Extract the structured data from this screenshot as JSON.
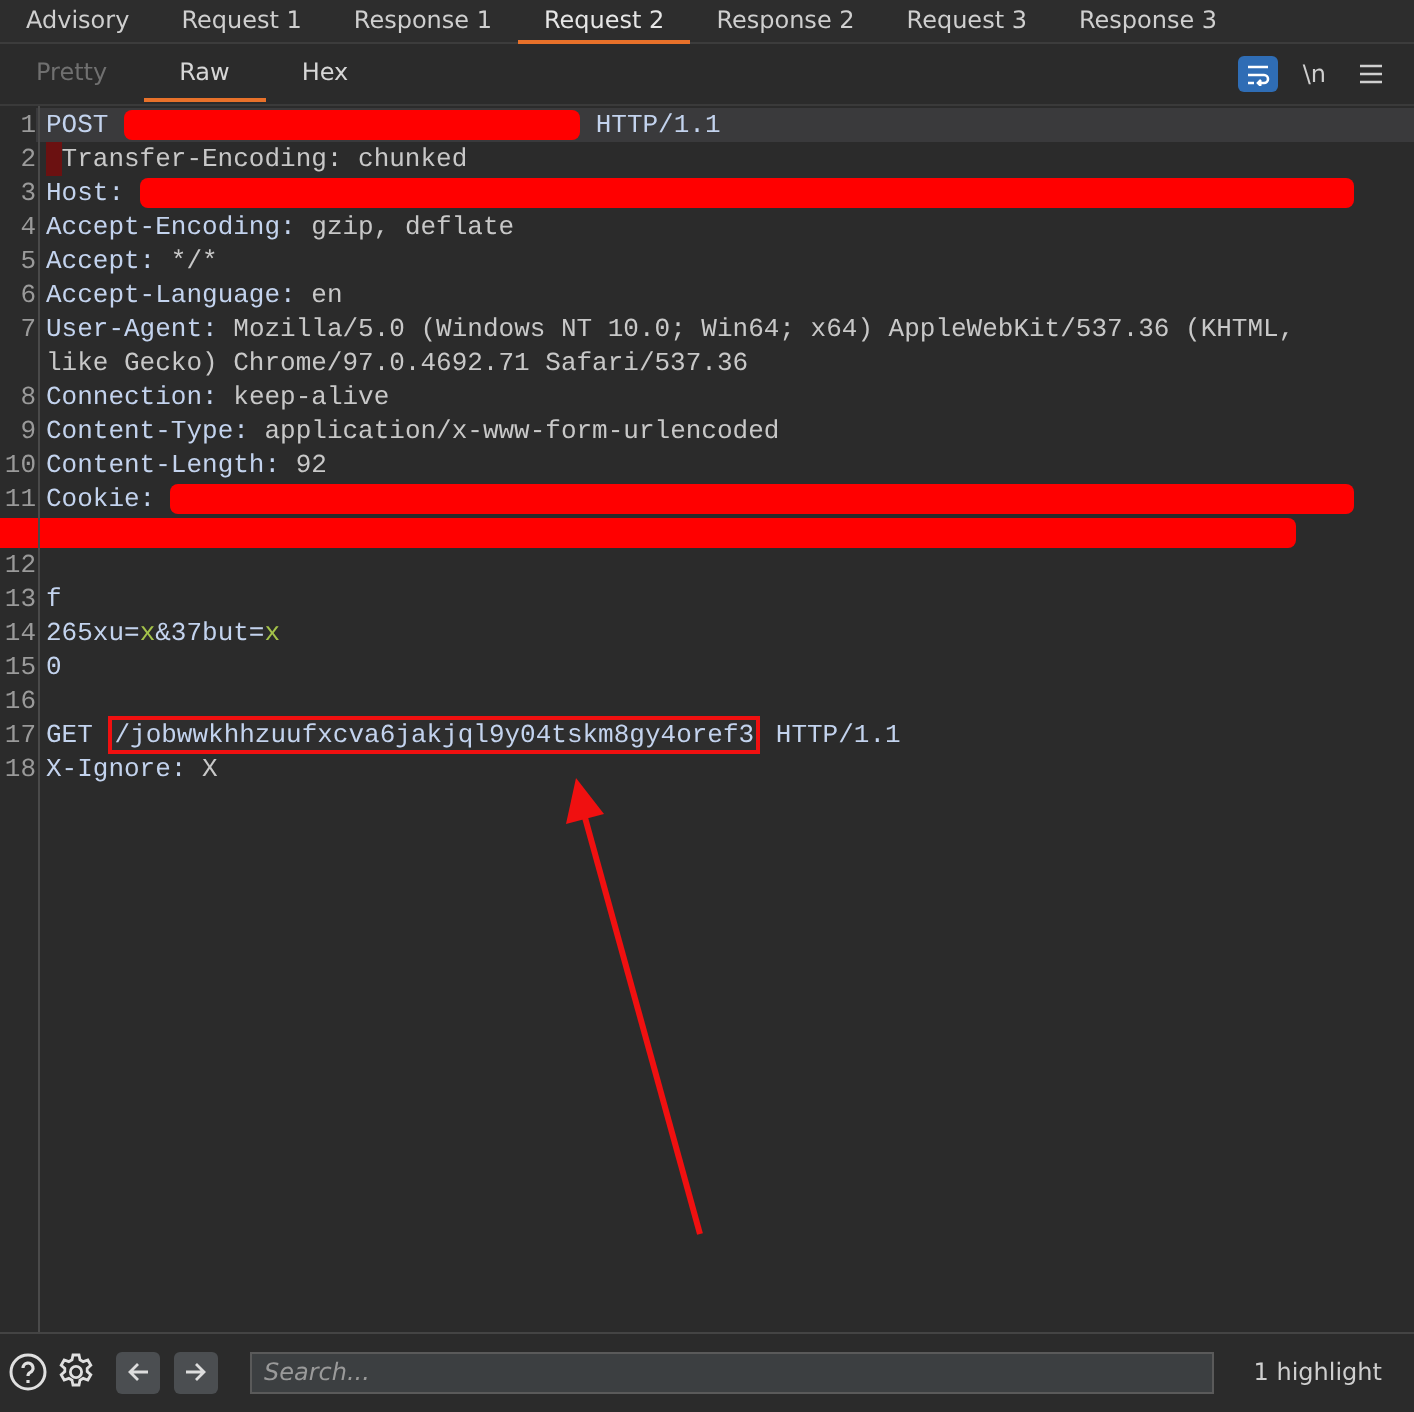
{
  "message_tabs": [
    {
      "label": "Advisory",
      "selected": false
    },
    {
      "label": "Request 1",
      "selected": false
    },
    {
      "label": "Response 1",
      "selected": false
    },
    {
      "label": "Request 2",
      "selected": true
    },
    {
      "label": "Response 2",
      "selected": false
    },
    {
      "label": "Request 3",
      "selected": false
    },
    {
      "label": "Response 3",
      "selected": false
    }
  ],
  "view_tabs": [
    {
      "label": "Pretty",
      "selected": false,
      "disabled": true
    },
    {
      "label": "Raw",
      "selected": true,
      "disabled": false
    },
    {
      "label": "Hex",
      "selected": false,
      "disabled": false
    }
  ],
  "toolbar": {
    "wrap_on": true,
    "newline_toggle": "\\n"
  },
  "editor_lines": [
    {
      "number": "1",
      "current": true,
      "segments": [
        {
          "kind": "name",
          "text": "POST"
        },
        {
          "kind": "redaction_short"
        },
        {
          "kind": "name",
          "text": "HTTP/1.1"
        }
      ]
    },
    {
      "number": "2",
      "current": false,
      "segments": [
        {
          "kind": "marker"
        },
        {
          "kind": "value",
          "text": "Transfer-Encoding: chunked"
        }
      ]
    },
    {
      "number": "3",
      "current": false,
      "segments": [
        {
          "kind": "name",
          "text": "Host:"
        },
        {
          "kind": "redaction"
        }
      ]
    },
    {
      "number": "4",
      "current": false,
      "segments": [
        {
          "kind": "name",
          "text": "Accept-Encoding:"
        },
        {
          "kind": "value",
          "text": "gzip, deflate"
        }
      ]
    },
    {
      "number": "5",
      "current": false,
      "segments": [
        {
          "kind": "name",
          "text": "Accept:"
        },
        {
          "kind": "value",
          "text": "*/*"
        }
      ]
    },
    {
      "number": "6",
      "current": false,
      "segments": [
        {
          "kind": "name",
          "text": "Accept-Language:"
        },
        {
          "kind": "value",
          "text": "en"
        }
      ]
    },
    {
      "number": "7",
      "current": false,
      "segments": [
        {
          "kind": "name",
          "text": "User-Agent:"
        },
        {
          "kind": "value",
          "text": "Mozilla/5.0 (Windows NT 10.0; Win64; x64) AppleWebKit/537.36 (KHTML, like Gecko) Chrome/97.0.4692.71 Safari/537.36"
        }
      ]
    },
    {
      "number": "8",
      "current": false,
      "segments": [
        {
          "kind": "name",
          "text": "Connection:"
        },
        {
          "kind": "value",
          "text": "keep-alive"
        }
      ]
    },
    {
      "number": "9",
      "current": false,
      "segments": [
        {
          "kind": "name",
          "text": "Content-Type:"
        },
        {
          "kind": "value",
          "text": "application/x-www-form-urlencoded"
        }
      ]
    },
    {
      "number": "10",
      "current": false,
      "segments": [
        {
          "kind": "name",
          "text": "Content-Length:"
        },
        {
          "kind": "value",
          "text": "92"
        }
      ]
    },
    {
      "number": "11",
      "current": false,
      "segments": [
        {
          "kind": "name",
          "text": "Cookie:"
        },
        {
          "kind": "redaction"
        },
        {
          "kind": "redaction_row"
        }
      ]
    },
    {
      "number": "12",
      "current": false
    },
    {
      "number": "13",
      "current": false,
      "segments": [
        {
          "kind": "body",
          "text": "f"
        }
      ]
    },
    {
      "number": "14",
      "current": false,
      "segments": [
        {
          "kind": "body",
          "text": "265xu="
        },
        {
          "kind": "param",
          "text": "x"
        },
        {
          "kind": "body",
          "text": "&37but="
        },
        {
          "kind": "param",
          "text": "x"
        }
      ]
    },
    {
      "number": "15",
      "current": false,
      "segments": [
        {
          "kind": "body",
          "text": "0"
        }
      ]
    },
    {
      "number": "16",
      "current": false
    },
    {
      "number": "17",
      "current": false,
      "segments": [
        {
          "kind": "name",
          "text": "GET"
        },
        {
          "kind": "boxed",
          "text": "/jobwwkhhzuufxcva6jakjql9y04tskm8gy4oref3"
        },
        {
          "kind": "name",
          "text": "HTTP/1.1"
        }
      ]
    },
    {
      "number": "18",
      "current": false,
      "segments": [
        {
          "kind": "name",
          "text": "X-Ignore:"
        },
        {
          "kind": "value",
          "text": "X"
        }
      ]
    }
  ],
  "footer": {
    "search": {
      "placeholder": "Search..."
    },
    "highlight_count": "1 highlight"
  }
}
